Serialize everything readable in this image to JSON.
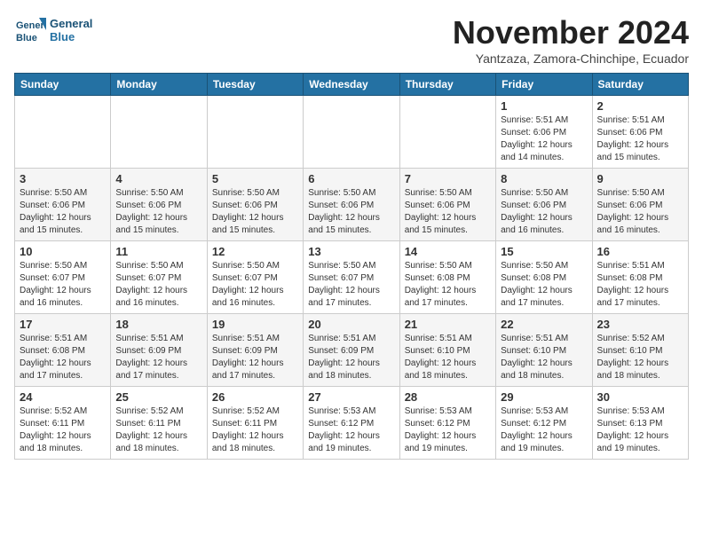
{
  "logo": {
    "line1": "General",
    "line2": "Blue"
  },
  "title": "November 2024",
  "subtitle": "Yantzaza, Zamora-Chinchipe, Ecuador",
  "weekdays": [
    "Sunday",
    "Monday",
    "Tuesday",
    "Wednesday",
    "Thursday",
    "Friday",
    "Saturday"
  ],
  "weeks": [
    [
      {
        "day": "",
        "info": ""
      },
      {
        "day": "",
        "info": ""
      },
      {
        "day": "",
        "info": ""
      },
      {
        "day": "",
        "info": ""
      },
      {
        "day": "",
        "info": ""
      },
      {
        "day": "1",
        "info": "Sunrise: 5:51 AM\nSunset: 6:06 PM\nDaylight: 12 hours\nand 14 minutes."
      },
      {
        "day": "2",
        "info": "Sunrise: 5:51 AM\nSunset: 6:06 PM\nDaylight: 12 hours\nand 15 minutes."
      }
    ],
    [
      {
        "day": "3",
        "info": "Sunrise: 5:50 AM\nSunset: 6:06 PM\nDaylight: 12 hours\nand 15 minutes."
      },
      {
        "day": "4",
        "info": "Sunrise: 5:50 AM\nSunset: 6:06 PM\nDaylight: 12 hours\nand 15 minutes."
      },
      {
        "day": "5",
        "info": "Sunrise: 5:50 AM\nSunset: 6:06 PM\nDaylight: 12 hours\nand 15 minutes."
      },
      {
        "day": "6",
        "info": "Sunrise: 5:50 AM\nSunset: 6:06 PM\nDaylight: 12 hours\nand 15 minutes."
      },
      {
        "day": "7",
        "info": "Sunrise: 5:50 AM\nSunset: 6:06 PM\nDaylight: 12 hours\nand 15 minutes."
      },
      {
        "day": "8",
        "info": "Sunrise: 5:50 AM\nSunset: 6:06 PM\nDaylight: 12 hours\nand 16 minutes."
      },
      {
        "day": "9",
        "info": "Sunrise: 5:50 AM\nSunset: 6:06 PM\nDaylight: 12 hours\nand 16 minutes."
      }
    ],
    [
      {
        "day": "10",
        "info": "Sunrise: 5:50 AM\nSunset: 6:07 PM\nDaylight: 12 hours\nand 16 minutes."
      },
      {
        "day": "11",
        "info": "Sunrise: 5:50 AM\nSunset: 6:07 PM\nDaylight: 12 hours\nand 16 minutes."
      },
      {
        "day": "12",
        "info": "Sunrise: 5:50 AM\nSunset: 6:07 PM\nDaylight: 12 hours\nand 16 minutes."
      },
      {
        "day": "13",
        "info": "Sunrise: 5:50 AM\nSunset: 6:07 PM\nDaylight: 12 hours\nand 17 minutes."
      },
      {
        "day": "14",
        "info": "Sunrise: 5:50 AM\nSunset: 6:08 PM\nDaylight: 12 hours\nand 17 minutes."
      },
      {
        "day": "15",
        "info": "Sunrise: 5:50 AM\nSunset: 6:08 PM\nDaylight: 12 hours\nand 17 minutes."
      },
      {
        "day": "16",
        "info": "Sunrise: 5:51 AM\nSunset: 6:08 PM\nDaylight: 12 hours\nand 17 minutes."
      }
    ],
    [
      {
        "day": "17",
        "info": "Sunrise: 5:51 AM\nSunset: 6:08 PM\nDaylight: 12 hours\nand 17 minutes."
      },
      {
        "day": "18",
        "info": "Sunrise: 5:51 AM\nSunset: 6:09 PM\nDaylight: 12 hours\nand 17 minutes."
      },
      {
        "day": "19",
        "info": "Sunrise: 5:51 AM\nSunset: 6:09 PM\nDaylight: 12 hours\nand 17 minutes."
      },
      {
        "day": "20",
        "info": "Sunrise: 5:51 AM\nSunset: 6:09 PM\nDaylight: 12 hours\nand 18 minutes."
      },
      {
        "day": "21",
        "info": "Sunrise: 5:51 AM\nSunset: 6:10 PM\nDaylight: 12 hours\nand 18 minutes."
      },
      {
        "day": "22",
        "info": "Sunrise: 5:51 AM\nSunset: 6:10 PM\nDaylight: 12 hours\nand 18 minutes."
      },
      {
        "day": "23",
        "info": "Sunrise: 5:52 AM\nSunset: 6:10 PM\nDaylight: 12 hours\nand 18 minutes."
      }
    ],
    [
      {
        "day": "24",
        "info": "Sunrise: 5:52 AM\nSunset: 6:11 PM\nDaylight: 12 hours\nand 18 minutes."
      },
      {
        "day": "25",
        "info": "Sunrise: 5:52 AM\nSunset: 6:11 PM\nDaylight: 12 hours\nand 18 minutes."
      },
      {
        "day": "26",
        "info": "Sunrise: 5:52 AM\nSunset: 6:11 PM\nDaylight: 12 hours\nand 18 minutes."
      },
      {
        "day": "27",
        "info": "Sunrise: 5:53 AM\nSunset: 6:12 PM\nDaylight: 12 hours\nand 19 minutes."
      },
      {
        "day": "28",
        "info": "Sunrise: 5:53 AM\nSunset: 6:12 PM\nDaylight: 12 hours\nand 19 minutes."
      },
      {
        "day": "29",
        "info": "Sunrise: 5:53 AM\nSunset: 6:12 PM\nDaylight: 12 hours\nand 19 minutes."
      },
      {
        "day": "30",
        "info": "Sunrise: 5:53 AM\nSunset: 6:13 PM\nDaylight: 12 hours\nand 19 minutes."
      }
    ]
  ]
}
